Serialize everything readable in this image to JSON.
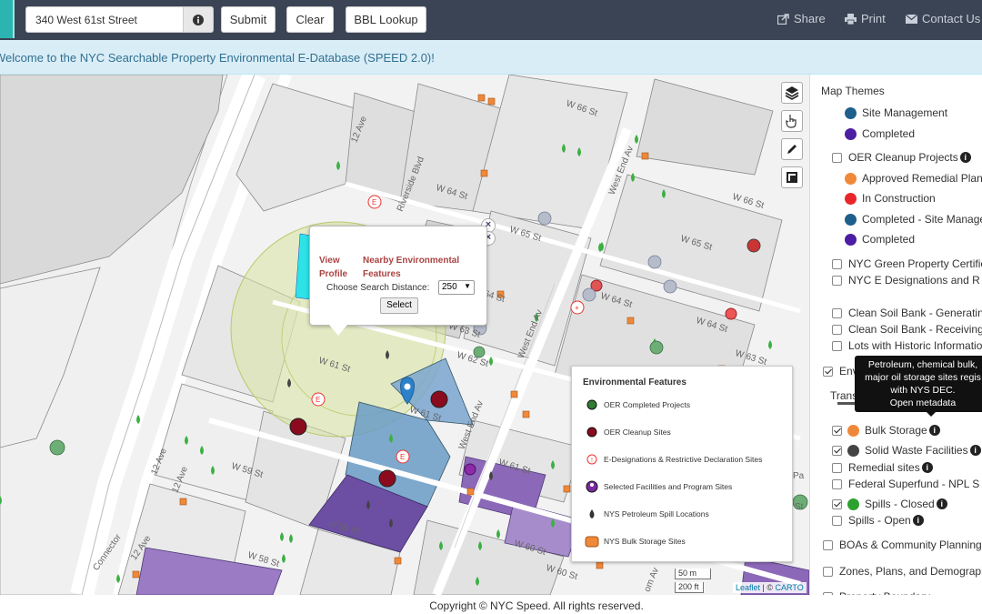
{
  "header": {
    "search_value": "340 West 61st Street",
    "submit_label": "Submit",
    "clear_label": "Clear",
    "bbl_label": "BBL Lookup",
    "share_label": "Share",
    "print_label": "Print",
    "contact_label": "Contact Us"
  },
  "banner": {
    "text": "Welcome to the NYC Searchable Property Environmental E-Database (SPEED 2.0)!"
  },
  "map": {
    "streets": [
      "W 66 St",
      "W 65 St",
      "W 64 St",
      "W 64 St",
      "W 65 St",
      "W 64 St",
      "W 63 St",
      "W 62 St",
      "W 61 St",
      "W 61 St",
      "W 61 St",
      "W 60 St",
      "W 59 St",
      "W 59 St",
      "W 58 St",
      "W 66 St",
      "W 64 St",
      "W 63 St",
      "W 60 St",
      "12 Ave",
      "12 Ave",
      "12 Ave",
      "12 Ave",
      "Riverside Blvd",
      "West End Av",
      "West End Av",
      "West End Av",
      "Connector",
      "Pa",
      "om Av",
      "St"
    ],
    "popup": {
      "view_profile": "View Profile",
      "nearby": "Nearby Environmental Features",
      "distance_label": "Choose Search Distance:",
      "distance_value": "250",
      "select_label": "Select"
    },
    "legend": {
      "title": "Environmental Features",
      "items": [
        {
          "label": "OER Completed Projects",
          "icon": "green-check-icon"
        },
        {
          "label": "OER Cleanup Sites",
          "icon": "maroon-shovel-icon"
        },
        {
          "label": "E-Designations & Restrictive Declaration Sites",
          "icon": "e-designation-icon"
        },
        {
          "label": "Selected Facilities and Program Sites",
          "icon": "purple-person-icon"
        },
        {
          "label": "NYS Petroleum Spill Locations",
          "icon": "dark-drop-icon"
        },
        {
          "label": "NYS Bulk Storage Sites",
          "icon": "orange-tank-icon"
        }
      ]
    },
    "scale_m": "50 m",
    "scale_ft": "200 ft",
    "attribution_leaflet": "Leaflet",
    "attribution_sep": "| ©",
    "attribution_carto": "CARTO"
  },
  "sidebar": {
    "title": "Map Themes",
    "items": [
      {
        "type": "dot",
        "label": "Site Management",
        "color": "#1f5f8b"
      },
      {
        "type": "dot",
        "label": "Completed",
        "color": "#4b1ea3"
      },
      {
        "type": "check",
        "label": "OER Cleanup Projects",
        "checked": false,
        "info": true
      },
      {
        "type": "dot",
        "label": "Approved Remedial Plan",
        "color": "#f0883a"
      },
      {
        "type": "dot",
        "label": "In Construction",
        "color": "#e8262a"
      },
      {
        "type": "dot",
        "label": "Completed - Site Management",
        "color": "#1f5f8b"
      },
      {
        "type": "dot",
        "label": "Completed",
        "color": "#4b1ea3"
      },
      {
        "type": "check",
        "label": "NYC Green Property Certification",
        "checked": false
      },
      {
        "type": "check",
        "label": "NYC E Designations and R",
        "checked": false
      },
      {
        "type": "check",
        "label": "Clean Soil Bank - Generating",
        "checked": false
      },
      {
        "type": "check",
        "label": "Clean Soil Bank - Receiving",
        "checked": false
      },
      {
        "type": "check",
        "label": "Lots with Historic Information",
        "checked": false
      },
      {
        "type": "check",
        "label": "Envi",
        "checked": true
      },
      {
        "type": "text",
        "label": "Transparency"
      },
      {
        "type": "check",
        "label": "Bulk Storage",
        "checked": true,
        "info": true,
        "color": "#f0883a"
      },
      {
        "type": "check",
        "label": "Solid Waste Facilities",
        "checked": true,
        "info": true,
        "color": "#444"
      },
      {
        "type": "check",
        "label": "Remedial sites",
        "checked": false,
        "info": true
      },
      {
        "type": "check",
        "label": "Federal Superfund - NPL S",
        "checked": false
      },
      {
        "type": "check",
        "label": "Spills - Closed",
        "checked": true,
        "info": true,
        "color": "#2ea02e"
      },
      {
        "type": "check",
        "label": "Spills - Open",
        "checked": false,
        "info": true
      },
      {
        "type": "check",
        "label": "BOAs & Community Planning",
        "checked": false
      },
      {
        "type": "check",
        "label": "Zones, Plans, and Demographics",
        "checked": false
      },
      {
        "type": "check",
        "label": "Property Boundary",
        "checked": true
      }
    ],
    "tooltip_lines": [
      "Petroleum, chemical bulk,",
      "major oil storage sites regis",
      "with NYS DEC.",
      "Open metadata"
    ]
  },
  "footer": {
    "copyright": "Copyright © NYC Speed. All rights reserved."
  }
}
